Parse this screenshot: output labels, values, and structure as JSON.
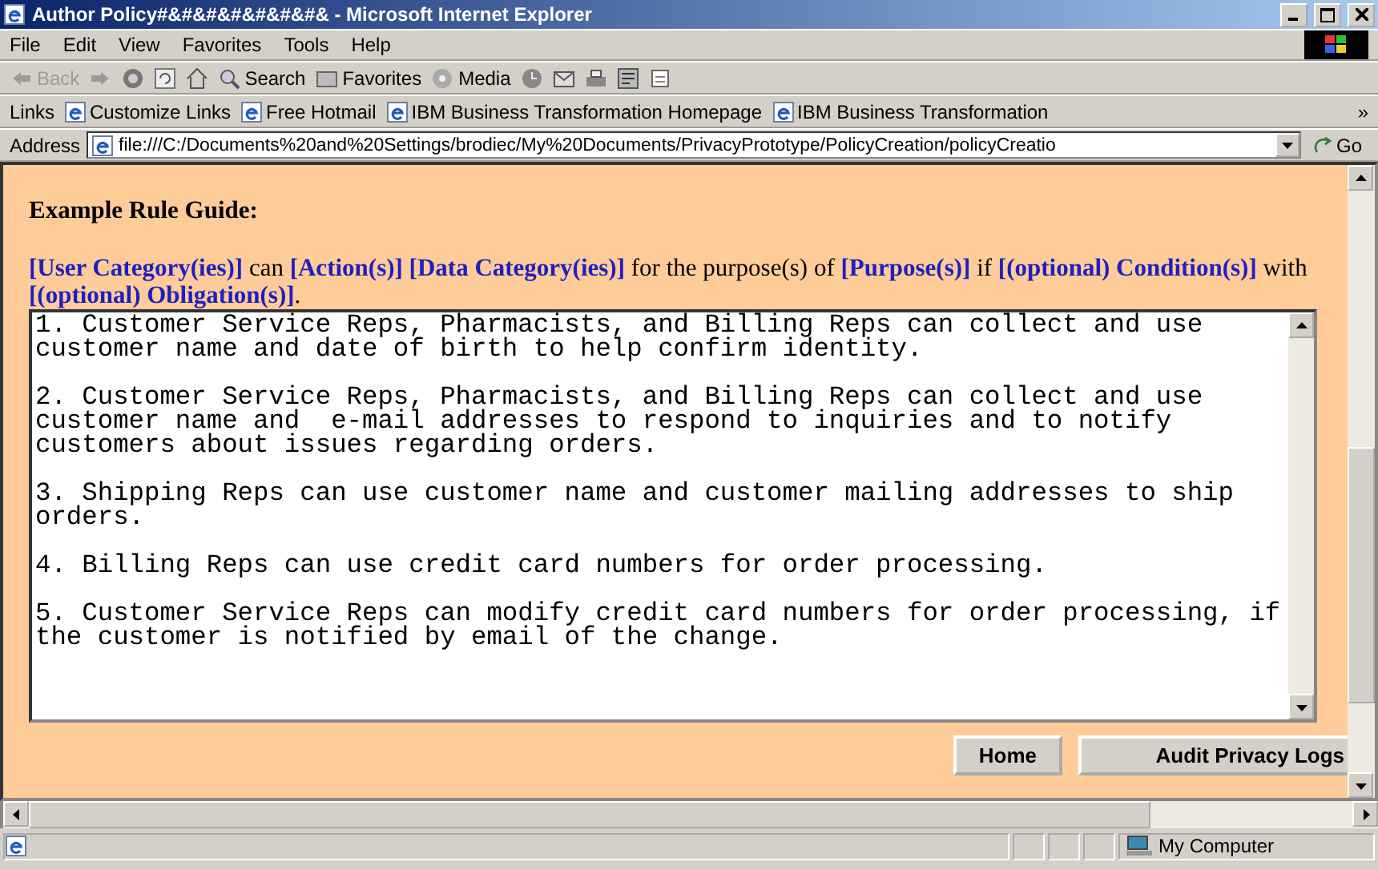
{
  "window": {
    "title": "Author Policy#&#&#&#&#&#&#& - Microsoft Internet Explorer"
  },
  "menu": [
    "File",
    "Edit",
    "View",
    "Favorites",
    "Tools",
    "Help"
  ],
  "toolbar": [
    {
      "kind": "back",
      "label": "Back",
      "disabled": true
    },
    {
      "kind": "forward"
    },
    {
      "kind": "stop"
    },
    {
      "kind": "refresh"
    },
    {
      "kind": "home"
    },
    {
      "kind": "search",
      "label": "Search"
    },
    {
      "kind": "favorites",
      "label": "Favorites"
    },
    {
      "kind": "media",
      "label": "Media"
    },
    {
      "kind": "history"
    },
    {
      "kind": "mail"
    },
    {
      "kind": "print"
    },
    {
      "kind": "edit"
    },
    {
      "kind": "discuss"
    }
  ],
  "links": {
    "label": "Links",
    "items": [
      "Customize Links",
      "Free Hotmail",
      "IBM Business Transformation Homepage",
      "IBM Business Transformation"
    ],
    "more": "»"
  },
  "address": {
    "label": "Address",
    "value": "file:///C:/Documents%20and%20Settings/brodiec/My%20Documents/PrivacyPrototype/PolicyCreation/policyCreatio",
    "go": "Go"
  },
  "page": {
    "heading": "Example Rule Guide:",
    "guide": "**[User Category(ies)]** can **[Action(s)]** **[Data Category(ies)]** for the purpose(s) of **[Purpose(s)]** if **[(optional) Condition(s)]** with **[(optional) Obligation(s)]**.",
    "rules": [
      "1. Customer Service Reps, Pharmacists, and Billing Reps can collect and use customer name and date of birth to help confirm identity.",
      "2. Customer Service Reps, Pharmacists, and Billing Reps can collect and use customer name and  e-mail addresses to respond to inquiries and to notify customers about issues regarding orders.",
      "3. Shipping Reps can use customer name and customer mailing addresses to ship orders.",
      "4. Billing Reps can use credit card numbers for order processing.",
      "5. Customer Service Reps can modify credit card numbers for order processing, if the customer is notified by email of the change."
    ],
    "buttons": [
      "Home",
      "Audit Privacy Logs"
    ]
  },
  "status_bar": {
    "zone": "My Computer"
  }
}
